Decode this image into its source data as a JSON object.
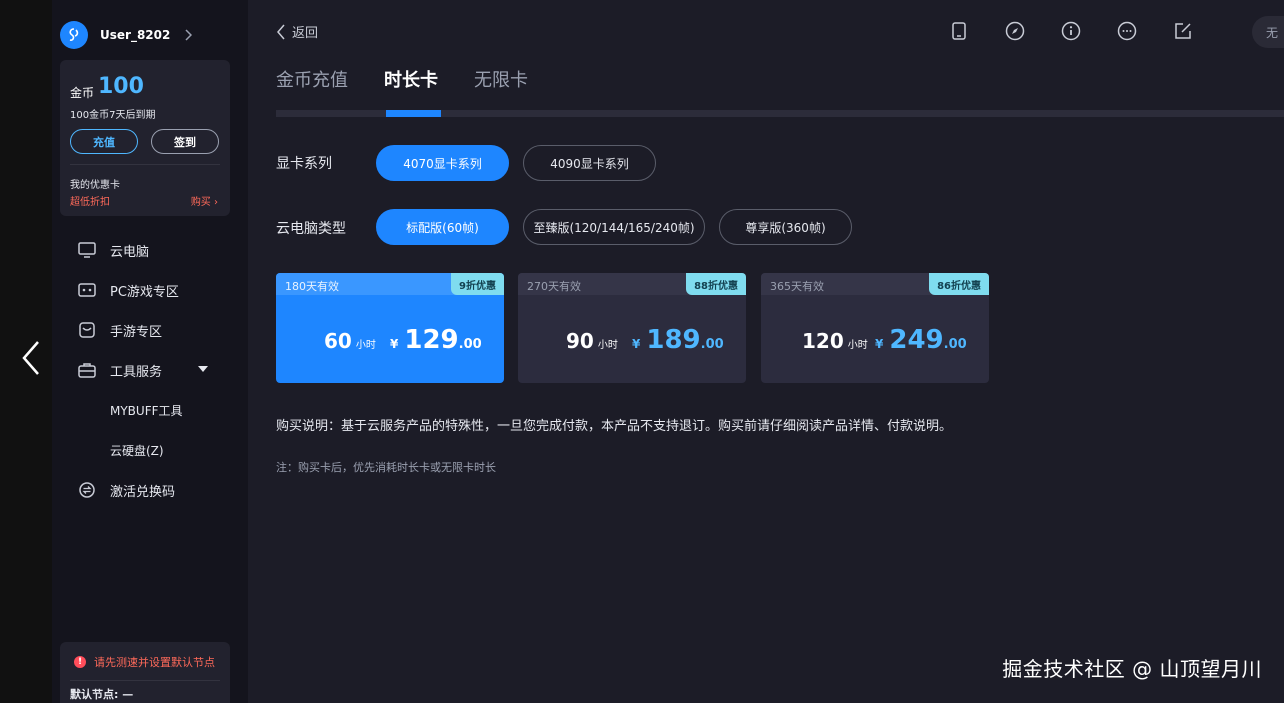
{
  "sidebar": {
    "username": "User_8202",
    "coin_label": "金币",
    "coin_value": "100",
    "coin_expire": "100金币7天后到期",
    "recharge_label": "充值",
    "signin_label": "签到",
    "coupon_title": "我的优惠卡",
    "coupon_sub": "超低折扣",
    "coupon_buy": "购买",
    "nav": [
      {
        "label": "云电脑",
        "icon": "monitor-icon"
      },
      {
        "label": "PC游戏专区",
        "icon": "gamepad-icon"
      },
      {
        "label": "手游专区",
        "icon": "mobile-game-icon"
      },
      {
        "label": "工具服务",
        "icon": "toolbox-icon"
      },
      {
        "label": "MYBUFF工具"
      },
      {
        "label": "云硬盘(Z)"
      },
      {
        "label": "激活兑换码",
        "icon": "exchange-icon"
      }
    ],
    "notice_text": "请先测速并设置默认节点",
    "default_node": "默认节点: —"
  },
  "header": {
    "back_label": "返回",
    "top_button": "无",
    "icons": [
      "tablet-icon",
      "compass-icon",
      "info-icon",
      "chat-icon",
      "edit-icon"
    ]
  },
  "tabs": [
    "金币充值",
    "时长卡",
    "无限卡"
  ],
  "active_tab": "时长卡",
  "gpu_series": {
    "label": "显卡系列",
    "options": [
      "4070显卡系列",
      "4090显卡系列"
    ],
    "selected": "4070显卡系列"
  },
  "pc_type": {
    "label": "云电脑类型",
    "options": [
      "标配版(60帧)",
      "至臻版(120/144/165/240帧)",
      "尊享版(360帧)"
    ],
    "selected": "标配版(60帧)"
  },
  "cards": [
    {
      "validity": "180天有效",
      "badge": "9折优惠",
      "hours": "60",
      "hours_unit": "小时",
      "currency": "¥",
      "price_int": "129",
      "price_dec": ".00",
      "selected": true
    },
    {
      "validity": "270天有效",
      "badge": "88折优惠",
      "hours": "90",
      "hours_unit": "小时",
      "currency": "¥",
      "price_int": "189",
      "price_dec": ".00",
      "selected": false
    },
    {
      "validity": "365天有效",
      "badge": "86折优惠",
      "hours": "120",
      "hours_unit": "小时",
      "currency": "¥",
      "price_int": "249",
      "price_dec": ".00",
      "selected": false
    }
  ],
  "note_main": "购买说明：基于云服务产品的特殊性，一旦您完成付款，本产品不支持退订。购买前请仔细阅读产品详情、付款说明。",
  "note_sub": "注：购买卡后，优先消耗时长卡或无限卡时长",
  "watermark": "掘金技术社区 @ 山顶望月川",
  "colors": {
    "accent": "#1e86ff",
    "badge": "#7fdcef",
    "warning": "#ff6a5a",
    "price": "#4fb7ff"
  }
}
